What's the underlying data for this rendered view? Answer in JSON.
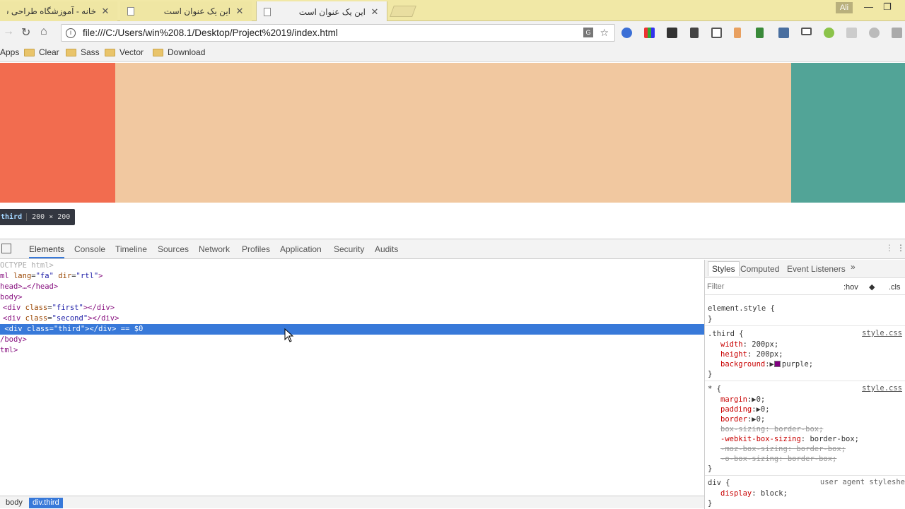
{
  "tabs": [
    {
      "title": "خانه - آموزشگاه طراحی سا",
      "active": false
    },
    {
      "title": "این یک عنوان است",
      "active": false
    },
    {
      "title": "این یک عنوان است",
      "active": true
    }
  ],
  "profile_name": "Ali",
  "address": {
    "url": "file:///C:/Users/win%208.1/Desktop/Project%2019/index.html"
  },
  "bookmarks": [
    "Apps",
    "Clear",
    "Sass",
    "Vector",
    "Download"
  ],
  "page": {
    "boxes": [
      {
        "name": "first",
        "color": "#f26c4f"
      },
      {
        "name": "second",
        "color": "#f1c8a0"
      },
      {
        "name": "third",
        "color": "#52a497"
      }
    ],
    "tooltip": {
      "selector": "third",
      "dims": "200 × 200"
    }
  },
  "devtools": {
    "tabs": [
      "Elements",
      "Console",
      "Timeline",
      "Sources",
      "Network",
      "Profiles",
      "Application",
      "Security",
      "Audits"
    ],
    "dom": {
      "doctype": "OCTYPE html>",
      "html_open_tag": "ml",
      "lang_attr": "lang",
      "lang_val": "\"fa\"",
      "dir_attr": "dir",
      "dir_val": "\"rtl\"",
      "head": "head>…</head>",
      "body_open": "body>",
      "div_tag": "<div",
      "class_attr": "class",
      "first_val": "\"first\"",
      "second_val": "\"second\"",
      "third_val": "\"third\"",
      "div_close": "></div>",
      "eq0": "== $0",
      "body_close": "/body>",
      "html_close": "tml>"
    },
    "styles": {
      "tabs": [
        "Styles",
        "Computed",
        "Event Listeners"
      ],
      "filter_placeholder": "Filter",
      "hov": ":hov",
      "cls": ".cls",
      "element_style": "element.style {",
      "close_brace": "}",
      "third_selector": ".third {",
      "third_source": "style.css",
      "width_prop": "width",
      "width_val": "200px;",
      "height_prop": "height",
      "height_val": "200px;",
      "bg_prop": "background",
      "bg_val": "purple;",
      "bg_color": "#800080",
      "star_selector": "* {",
      "star_source": "style.css",
      "margin_prop": "margin",
      "margin_val": "0;",
      "padding_prop": "padding",
      "padding_val": "0;",
      "border_prop": "border",
      "border_val": "0;",
      "bs_prop": "box-sizing",
      "bs_val": "border-box;",
      "wbs_prop": "-webkit-box-sizing",
      "wbs_val": "border-box;",
      "mbs_prop": "-moz-box-sizing",
      "mbs_val": "border-box;",
      "obs_prop": "-o-box-sizing",
      "obs_val": "border-box;",
      "div_selector": "div {",
      "ua_source": "user agent styleshe",
      "display_prop": "display",
      "display_val": "block;"
    },
    "breadcrumb": [
      "body",
      "div.third"
    ]
  }
}
